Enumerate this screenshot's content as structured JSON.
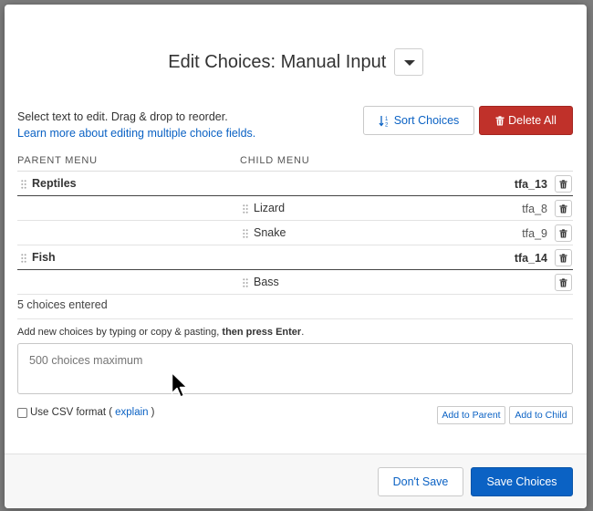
{
  "dialog": {
    "title": "Edit Choices: Manual Input"
  },
  "instructions": {
    "line1": "Select text to edit. Drag & drop to reorder.",
    "link": "Learn more about editing multiple choice fields."
  },
  "toolbar": {
    "sort_label": "Sort Choices",
    "delete_all_label": "Delete All"
  },
  "columns": {
    "parent": "PARENT MENU",
    "child": "CHILD MENU"
  },
  "rows": [
    {
      "level": "parent",
      "label": "Reptiles",
      "code": "tfa_13"
    },
    {
      "level": "child",
      "label": "Lizard",
      "code": "tfa_8"
    },
    {
      "level": "child",
      "label": "Snake",
      "code": "tfa_9"
    },
    {
      "level": "parent",
      "label": "Fish",
      "code": "tfa_14"
    },
    {
      "level": "child",
      "label": "Bass",
      "code": ""
    }
  ],
  "summary": {
    "count_text": "5 choices entered"
  },
  "add": {
    "instruction_prefix": "Add new choices by typing or copy & pasting, ",
    "instruction_bold": "then press Enter",
    "instruction_suffix": ".",
    "placeholder": "500 choices maximum",
    "csv_label": "Use CSV format (",
    "csv_link": "explain",
    "csv_close": ")",
    "add_parent_label": "Add to Parent",
    "add_child_label": "Add to Child"
  },
  "footer": {
    "dont_save_label": "Don't Save",
    "save_label": "Save Choices"
  },
  "colors": {
    "primary": "#0b62c4",
    "danger": "#c0312a"
  }
}
